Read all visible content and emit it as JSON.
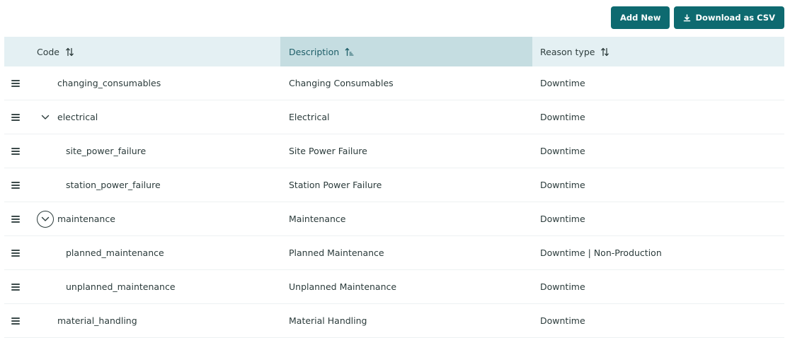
{
  "toolbar": {
    "add_new_label": "Add New",
    "download_label": "Download as CSV",
    "accent": "#0e6a70"
  },
  "table": {
    "headers": {
      "code": "Code",
      "description": "Description",
      "reason_type": "Reason type"
    },
    "sorted_column": "description",
    "header_bg": "#e4f0f3",
    "sorted_header_bg": "#c5dde1",
    "rows": [
      {
        "code": "changing_consumables",
        "description": "Changing Consumables",
        "reason_type": "Downtime"
      },
      {
        "code": "electrical",
        "description": "Electrical",
        "reason_type": "Downtime",
        "expanded": true
      },
      {
        "code": "site_power_failure",
        "description": "Site Power Failure",
        "reason_type": "Downtime"
      },
      {
        "code": "station_power_failure",
        "description": "Station Power Failure",
        "reason_type": "Downtime"
      },
      {
        "code": "maintenance",
        "description": "Maintenance",
        "reason_type": "Downtime",
        "expanded": true
      },
      {
        "code": "planned_maintenance",
        "description": "Planned Maintenance",
        "reason_type": "Downtime | Non-Production"
      },
      {
        "code": "unplanned_maintenance",
        "description": "Unplanned Maintenance",
        "reason_type": "Downtime"
      },
      {
        "code": "material_handling",
        "description": "Material Handling",
        "reason_type": "Downtime"
      }
    ]
  }
}
